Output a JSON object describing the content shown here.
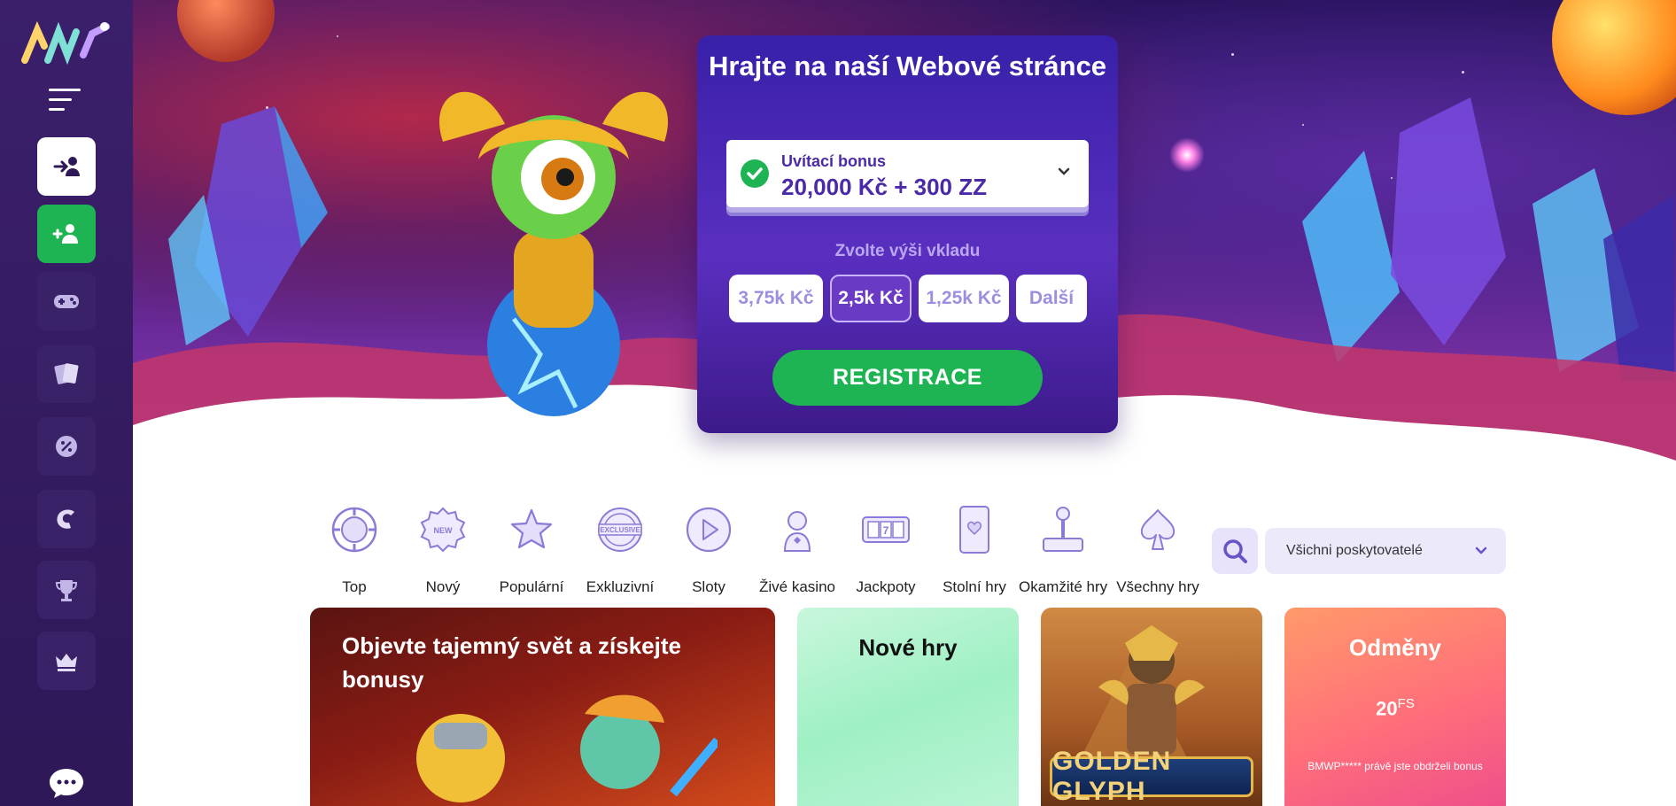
{
  "sidebar": {
    "logo_text": "AW",
    "items": [
      {
        "icon": "login-icon"
      },
      {
        "icon": "register-users-icon"
      },
      {
        "icon": "gamepad-icon"
      },
      {
        "icon": "cards-icon"
      },
      {
        "icon": "percent-badge-icon"
      },
      {
        "icon": "c-logo-icon"
      },
      {
        "icon": "trophy-icon"
      },
      {
        "icon": "crown-icon"
      }
    ]
  },
  "hero": {
    "title": "Hrajte na naší Webové stránce",
    "bonus_label": "Uvítací bonus",
    "bonus_value": "20,000 Kč + 300 ZZ",
    "deposit_label": "Zvolte výši vkladu",
    "amounts": [
      "3,75k Kč",
      "2,5k Kč",
      "1,25k Kč",
      "Další"
    ],
    "selected_amount": "2,5k Kč",
    "register_label": "REGISTRACE"
  },
  "categories": [
    {
      "label": "Top",
      "icon": "top-chip-icon"
    },
    {
      "label": "Nový",
      "icon": "new-badge-icon"
    },
    {
      "label": "Populární",
      "icon": "star-icon"
    },
    {
      "label": "Exkluzivní",
      "icon": "exclusive-badge-icon"
    },
    {
      "label": "Sloty",
      "icon": "play-icon"
    },
    {
      "label": "Živé kasino",
      "icon": "dealer-icon"
    },
    {
      "label": "Jackpoty",
      "icon": "slot-777-icon"
    },
    {
      "label": "Stolní hry",
      "icon": "playing-card-icon"
    },
    {
      "label": "Okamžité hry",
      "icon": "joystick-icon"
    },
    {
      "label": "Všechny hry",
      "icon": "spade-icon"
    }
  ],
  "provider_filter": {
    "selected": "Všichni poskytovatelé"
  },
  "tiles": {
    "promo_title": "Objevte tajemný svět a získejte bonusy",
    "new_games_title": "Nové hry",
    "game_logo": "GOLDEN GLYPH",
    "rewards_title": "Odměny",
    "rewards_amount": "20",
    "rewards_unit": "FS",
    "rewards_note": "BMWP***** právě jste obdrželi bonus"
  },
  "colors": {
    "sidebar": "#3b1f6b",
    "accent_green": "#1fb453",
    "card_purple": "#4b2aa8"
  }
}
